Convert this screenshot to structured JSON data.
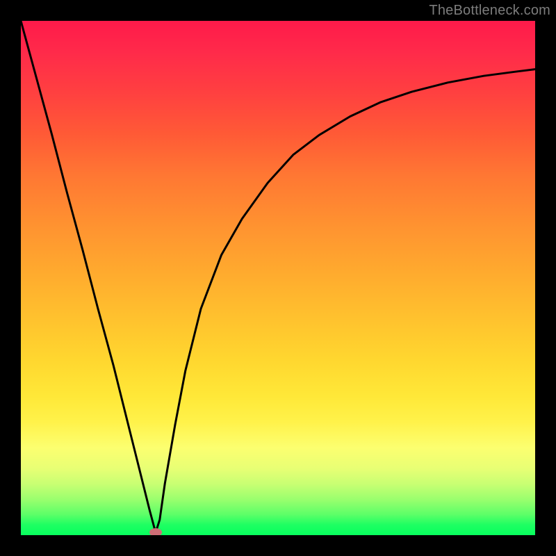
{
  "watermark": "TheBottleneck.com",
  "chart_data": {
    "type": "line",
    "title": "",
    "xlabel": "",
    "ylabel": "",
    "xlim": [
      0,
      1
    ],
    "ylim": [
      0,
      1
    ],
    "grid": false,
    "series": [
      {
        "name": "curve",
        "x": [
          0.0,
          0.03,
          0.06,
          0.09,
          0.12,
          0.15,
          0.18,
          0.21,
          0.23,
          0.25,
          0.262,
          0.27,
          0.28,
          0.3,
          0.32,
          0.35,
          0.39,
          0.43,
          0.48,
          0.53,
          0.58,
          0.64,
          0.7,
          0.76,
          0.83,
          0.9,
          0.96,
          1.0
        ],
        "values": [
          1.0,
          0.89,
          0.78,
          0.665,
          0.555,
          0.44,
          0.33,
          0.21,
          0.13,
          0.05,
          0.005,
          0.03,
          0.1,
          0.215,
          0.32,
          0.44,
          0.545,
          0.615,
          0.685,
          0.74,
          0.778,
          0.814,
          0.842,
          0.862,
          0.88,
          0.893,
          0.901,
          0.906
        ]
      }
    ],
    "annotations": [
      {
        "type": "marker",
        "x": 0.262,
        "y": 0.005,
        "color": "#ce6e76"
      }
    ],
    "background_gradient": {
      "direction": "vertical",
      "stops": [
        {
          "pos": 0.0,
          "color": "#ff1a4a"
        },
        {
          "pos": 0.5,
          "color": "#ffad2e"
        },
        {
          "pos": 0.8,
          "color": "#fcff70"
        },
        {
          "pos": 1.0,
          "color": "#07ff5e"
        }
      ]
    }
  },
  "colors": {
    "frame": "#000000",
    "curve": "#000000",
    "marker": "#ce6e76",
    "watermark": "#7c7c7c"
  }
}
